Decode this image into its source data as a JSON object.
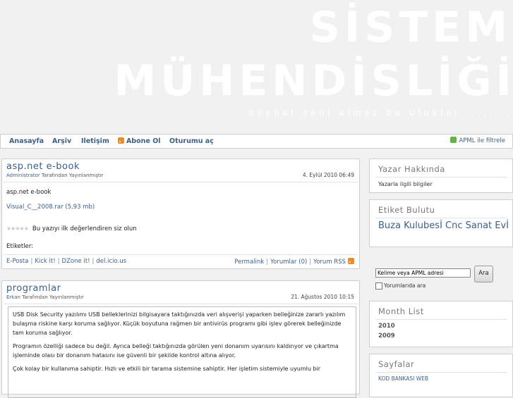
{
  "site": {
    "title_line1": "SİSTEM",
    "title_line2": "MÜHENDİSLİĞİ",
    "tagline": "heyhat seni almaz bu ufuklar........."
  },
  "nav": {
    "items": [
      "Anasayfa",
      "Arşiv",
      "Iletişim",
      "Abone Ol",
      "Oturumu aç"
    ],
    "apml_filter": "APML ile filtrele"
  },
  "posts": [
    {
      "title": "asp.net e-book",
      "author": "Administrator",
      "byline_suffix": " Tarafından Yayınlanmıştır",
      "date": "4. Eylül 2010 06:49",
      "body": "asp.net  e-book",
      "attachment": "Visual_C__2008.rar (5,93 mb)",
      "rating_text": "Bu yazıyı ilk değerlendiren siz olun",
      "tags_label": "Etiketler:",
      "links": [
        "E-Posta",
        "Kick it!",
        "DZone it!",
        "del.icio.us"
      ],
      "links_right": [
        "Permalink",
        "Yorumlar (0)",
        "Yorum RSS"
      ]
    },
    {
      "title": "programlar",
      "author": "Erkan",
      "byline_suffix": " Tarafından Yayınlanmıştır",
      "date": "21. Ağustos 2010 10:15",
      "paragraphs": [
        "USB Disk Security yazılımı USB belleklerinizi bilgisayara taktığınızda veri alışverişi yaparken belleğinize zararlı yazılım bulaşma riskine karşı koruma sağlıyor. Küçük boyutuna rağmen bir antivirüs programı gibi işlev görerek belleğinizde tam koruma sağlıyor.",
        "Programın özelliği sadece bu değil. Ayrıca belleği taktığınızda görülen yeni donanım uyarısını kaldırıyor ve çıkartma işleminde olası bir donanım hatasını ise güvenli bir şekilde kontrol altına alıyor.",
        "Çok kolay bir kullanıma sahiptir. Hızlı ve etkili bir tarama sistemine sahiptir. Her işletim sistemiyle uyumlu bir"
      ]
    }
  ],
  "sidebar": {
    "author_title": "Yazar Hakkında",
    "author_text": "Yazarla ilgili bilgiler",
    "tagcloud_title": "Etiket Bulutu",
    "tagcloud_tag": "Buza Kulubesİ Cnc Sanat Evİ",
    "search_placeholder": "Kelime veya APML adresi",
    "search_button": "Ara",
    "search_checkbox_label": "Yorumlarıda ara",
    "monthlist_title": "Month List",
    "years": [
      "2010",
      "2009"
    ],
    "pages_title": "Sayfalar",
    "pages_first": "KOD BANKASI WEB"
  },
  "colors": {
    "link": "#3d5f86",
    "background": "#f1f1f1",
    "rss": "#f08a24",
    "apml": "#67b446"
  }
}
